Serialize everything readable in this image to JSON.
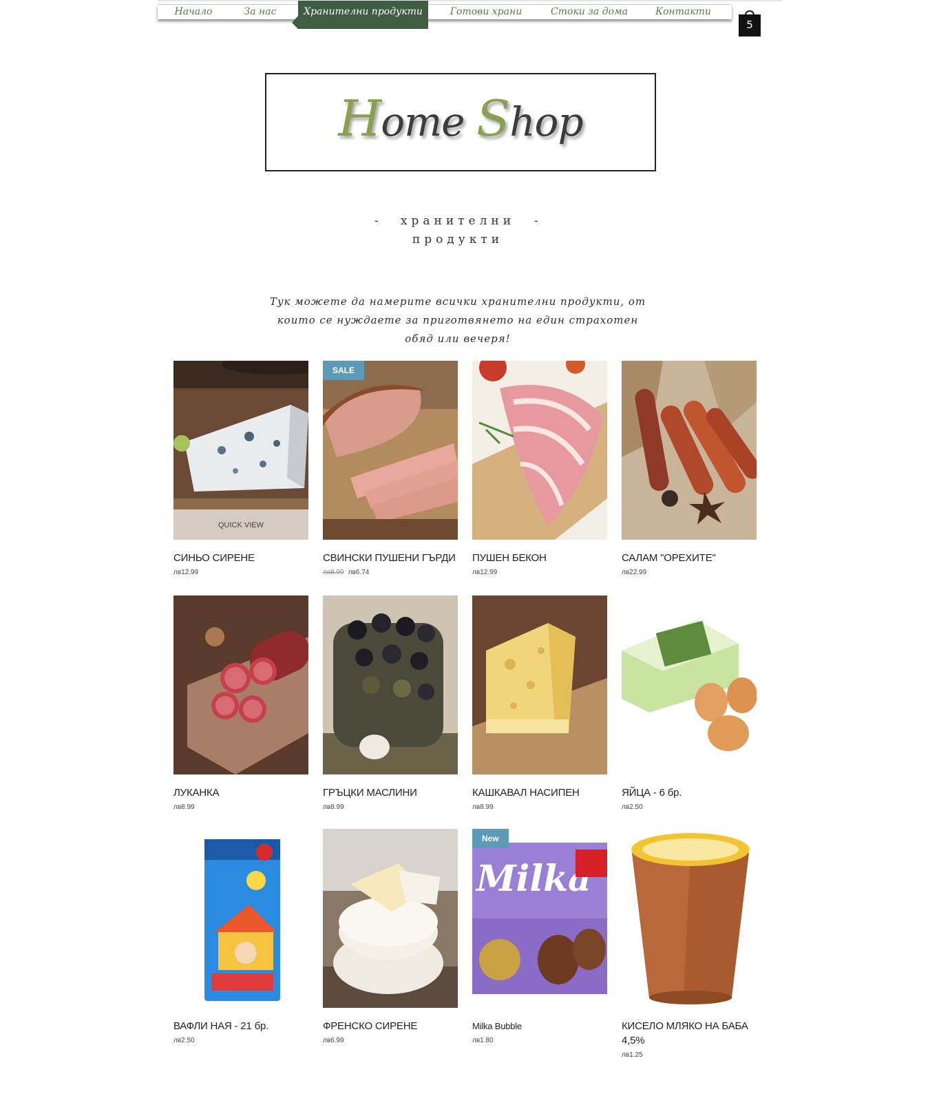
{
  "nav": {
    "items": [
      {
        "label": "Начало"
      },
      {
        "label": "За нас"
      },
      {
        "label": "Хранителни продукти"
      },
      {
        "label": "Готови храни"
      },
      {
        "label": "Стоки за дома"
      },
      {
        "label": "Контакти"
      }
    ],
    "active_index": 2
  },
  "cart": {
    "count": "5",
    "icon": "shopping-bag-icon"
  },
  "logo": {
    "part1_cap": "H",
    "part1_rest": "ome ",
    "part2_cap": "S",
    "part2_rest": "hop",
    "accent_color": "#8aa04f"
  },
  "category": {
    "dash": "-",
    "line1": "хранителни",
    "line2": "продукти"
  },
  "intro": "Тук можете да намерите всички хранителни продукти, от които се нуждаете за приготвянето на един страхотен обяд или вечеря!",
  "products": [
    {
      "name": "СИНЬО СИРЕНЕ",
      "price": "лв12.99",
      "quick_view": "QUICK VIEW"
    },
    {
      "name": "СВИНСКИ ПУШЕНИ ГЪРДИ",
      "old_price": "лв8.99",
      "price": "лв6.74",
      "ribbon": "SALE"
    },
    {
      "name": "ПУШЕН БЕКОН",
      "price": "лв12.99"
    },
    {
      "name": "САЛАМ \"ОРЕХИТЕ\"",
      "price": "лв22.99"
    },
    {
      "name": "ЛУКАНКА",
      "price": "лв8.99"
    },
    {
      "name": "ГРЪЦКИ МАСЛИНИ",
      "price": "лв8.99"
    },
    {
      "name": "КАШКАВАЛ НАСИПЕН",
      "price": "лв8.99"
    },
    {
      "name": "ЯЙЦА - 6 бр.",
      "price": "лв2.50"
    },
    {
      "name": "ВАФЛИ НАЯ - 21 бр.",
      "price": "лв2.50"
    },
    {
      "name": "ФРЕНСКО СИРЕНЕ",
      "price": "лв6.99"
    },
    {
      "name": "Milka Bubble",
      "price": "лв1.80",
      "ribbon": "New"
    },
    {
      "name": "КИСЕЛО МЛЯКО НА БАБА 4,5%",
      "price": "лв1.25"
    }
  ],
  "colors": {
    "nav_active": "#3f5d43",
    "nav_text": "#5b7a44",
    "ribbon": "#5c9ab8"
  }
}
